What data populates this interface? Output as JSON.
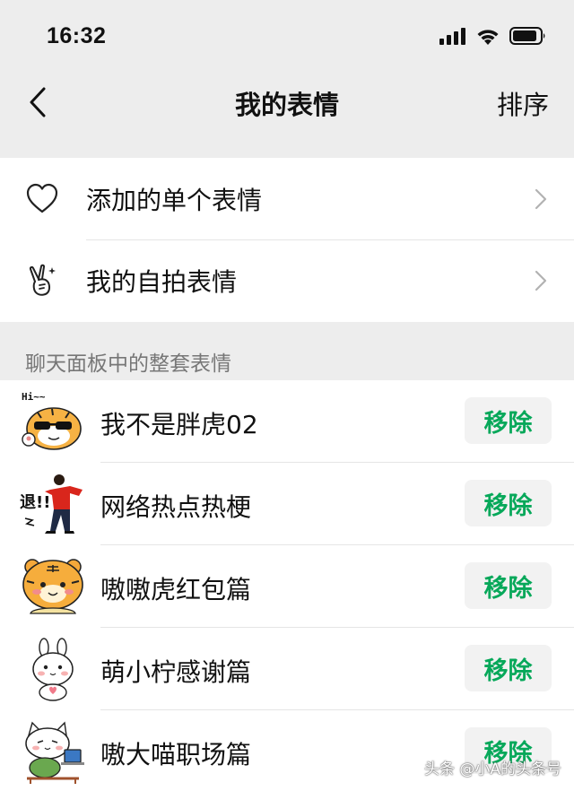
{
  "status_bar": {
    "time": "16:32",
    "icons": [
      "cellular-signal-icon",
      "wifi-icon",
      "battery-icon"
    ]
  },
  "nav": {
    "back_icon": "chevron-left-icon",
    "title": "我的表情",
    "action_label": "排序"
  },
  "menu": {
    "items": [
      {
        "label": "添加的单个表情",
        "icon": "heart-outline-icon"
      },
      {
        "label": "我的自拍表情",
        "icon": "victory-hand-icon"
      }
    ]
  },
  "section": {
    "title": "聊天面板中的整套表情"
  },
  "packs": [
    {
      "name": "我不是胖虎02",
      "thumb_caption": "Hi~~",
      "thumb_icon": "tiger-sunglasses-sticker",
      "action": "移除"
    },
    {
      "name": "网络热点热梗",
      "thumb_caption": "退!!",
      "thumb_icon": "man-waving-sticker",
      "action": "移除"
    },
    {
      "name": "嗷嗷虎红包篇",
      "thumb_caption": "",
      "thumb_icon": "tiger-face-sticker",
      "action": "移除"
    },
    {
      "name": "萌小柠感谢篇",
      "thumb_caption": "",
      "thumb_icon": "white-bunny-sticker",
      "action": "移除"
    },
    {
      "name": "嗷大喵职场篇",
      "thumb_caption": "",
      "thumb_icon": "white-cat-laptop-sticker",
      "action": "移除"
    }
  ],
  "watermark": "头条 @小A的头条号",
  "colors": {
    "accent": "#07a85a",
    "page_bg": "#ededed",
    "button_bg": "#f2f2f2"
  }
}
